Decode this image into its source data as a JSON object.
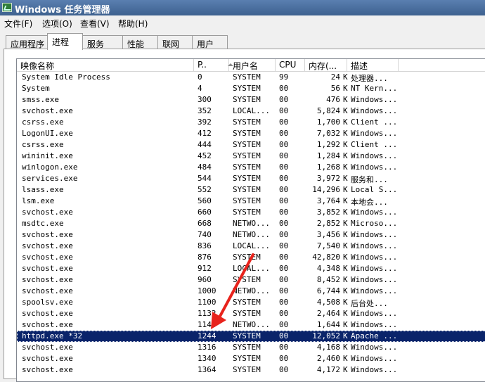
{
  "window": {
    "title": "Windows 任务管理器"
  },
  "menu": [
    "文件(F)",
    "选项(O)",
    "查看(V)",
    "帮助(H)"
  ],
  "tabs": [
    "应用程序",
    "进程",
    "服务",
    "性能",
    "联网",
    "用户"
  ],
  "active_tab": "进程",
  "columns": {
    "name": "映像名称",
    "pid": "P..",
    "user": "用户名",
    "cpu": "CPU",
    "mem": "内存(...",
    "desc": "描述"
  },
  "sort_icon": "sort-ascending-arrow",
  "processes": [
    {
      "name": "System Idle Process",
      "pid": "0",
      "user": "SYSTEM",
      "cpu": "99",
      "mem": "24",
      "unit": "K",
      "desc": "处理器..."
    },
    {
      "name": "System",
      "pid": "4",
      "user": "SYSTEM",
      "cpu": "00",
      "mem": "56",
      "unit": "K",
      "desc": "NT Kern..."
    },
    {
      "name": "smss.exe",
      "pid": "300",
      "user": "SYSTEM",
      "cpu": "00",
      "mem": "476",
      "unit": "K",
      "desc": "Windows..."
    },
    {
      "name": "svchost.exe",
      "pid": "352",
      "user": "LOCAL...",
      "cpu": "00",
      "mem": "5,824",
      "unit": "K",
      "desc": "Windows..."
    },
    {
      "name": "csrss.exe",
      "pid": "392",
      "user": "SYSTEM",
      "cpu": "00",
      "mem": "1,700",
      "unit": "K",
      "desc": "Client ..."
    },
    {
      "name": "LogonUI.exe",
      "pid": "412",
      "user": "SYSTEM",
      "cpu": "00",
      "mem": "7,032",
      "unit": "K",
      "desc": "Windows..."
    },
    {
      "name": "csrss.exe",
      "pid": "444",
      "user": "SYSTEM",
      "cpu": "00",
      "mem": "1,292",
      "unit": "K",
      "desc": "Client ..."
    },
    {
      "name": "wininit.exe",
      "pid": "452",
      "user": "SYSTEM",
      "cpu": "00",
      "mem": "1,284",
      "unit": "K",
      "desc": "Windows..."
    },
    {
      "name": "winlogon.exe",
      "pid": "484",
      "user": "SYSTEM",
      "cpu": "00",
      "mem": "1,268",
      "unit": "K",
      "desc": "Windows..."
    },
    {
      "name": "services.exe",
      "pid": "544",
      "user": "SYSTEM",
      "cpu": "00",
      "mem": "3,972",
      "unit": "K",
      "desc": "服务和..."
    },
    {
      "name": "lsass.exe",
      "pid": "552",
      "user": "SYSTEM",
      "cpu": "00",
      "mem": "14,296",
      "unit": "K",
      "desc": "Local S..."
    },
    {
      "name": "lsm.exe",
      "pid": "560",
      "user": "SYSTEM",
      "cpu": "00",
      "mem": "3,764",
      "unit": "K",
      "desc": "本地会..."
    },
    {
      "name": "svchost.exe",
      "pid": "660",
      "user": "SYSTEM",
      "cpu": "00",
      "mem": "3,852",
      "unit": "K",
      "desc": "Windows..."
    },
    {
      "name": "msdtc.exe",
      "pid": "668",
      "user": "NETWO...",
      "cpu": "00",
      "mem": "2,852",
      "unit": "K",
      "desc": "Microso..."
    },
    {
      "name": "svchost.exe",
      "pid": "740",
      "user": "NETWO...",
      "cpu": "00",
      "mem": "3,456",
      "unit": "K",
      "desc": "Windows..."
    },
    {
      "name": "svchost.exe",
      "pid": "836",
      "user": "LOCAL...",
      "cpu": "00",
      "mem": "7,540",
      "unit": "K",
      "desc": "Windows..."
    },
    {
      "name": "svchost.exe",
      "pid": "876",
      "user": "SYSTEM",
      "cpu": "00",
      "mem": "42,820",
      "unit": "K",
      "desc": "Windows..."
    },
    {
      "name": "svchost.exe",
      "pid": "912",
      "user": "LOCAL...",
      "cpu": "00",
      "mem": "4,348",
      "unit": "K",
      "desc": "Windows..."
    },
    {
      "name": "svchost.exe",
      "pid": "960",
      "user": "SYSTEM",
      "cpu": "00",
      "mem": "8,452",
      "unit": "K",
      "desc": "Windows..."
    },
    {
      "name": "svchost.exe",
      "pid": "1000",
      "user": "NETWO...",
      "cpu": "00",
      "mem": "6,744",
      "unit": "K",
      "desc": "Windows..."
    },
    {
      "name": "spoolsv.exe",
      "pid": "1100",
      "user": "SYSTEM",
      "cpu": "00",
      "mem": "4,508",
      "unit": "K",
      "desc": "后台处..."
    },
    {
      "name": "svchost.exe",
      "pid": "1132",
      "user": "SYSTEM",
      "cpu": "00",
      "mem": "2,464",
      "unit": "K",
      "desc": "Windows..."
    },
    {
      "name": "svchost.exe",
      "pid": "1148",
      "user": "NETWO...",
      "cpu": "00",
      "mem": "1,644",
      "unit": "K",
      "desc": "Windows..."
    },
    {
      "name": "httpd.exe *32",
      "pid": "1244",
      "user": "SYSTEM",
      "cpu": "00",
      "mem": "12,052",
      "unit": "K",
      "desc": "Apache ...",
      "selected": true
    },
    {
      "name": "svchost.exe",
      "pid": "1316",
      "user": "SYSTEM",
      "cpu": "00",
      "mem": "4,168",
      "unit": "K",
      "desc": "Windows..."
    },
    {
      "name": "svchost.exe",
      "pid": "1340",
      "user": "SYSTEM",
      "cpu": "00",
      "mem": "2,460",
      "unit": "K",
      "desc": "Windows..."
    },
    {
      "name": "svchost.exe",
      "pid": "1364",
      "user": "SYSTEM",
      "cpu": "00",
      "mem": "4,172",
      "unit": "K",
      "desc": "Windows..."
    }
  ],
  "annotation": {
    "icon": "red-arrow-icon",
    "color": "#e8231c"
  }
}
